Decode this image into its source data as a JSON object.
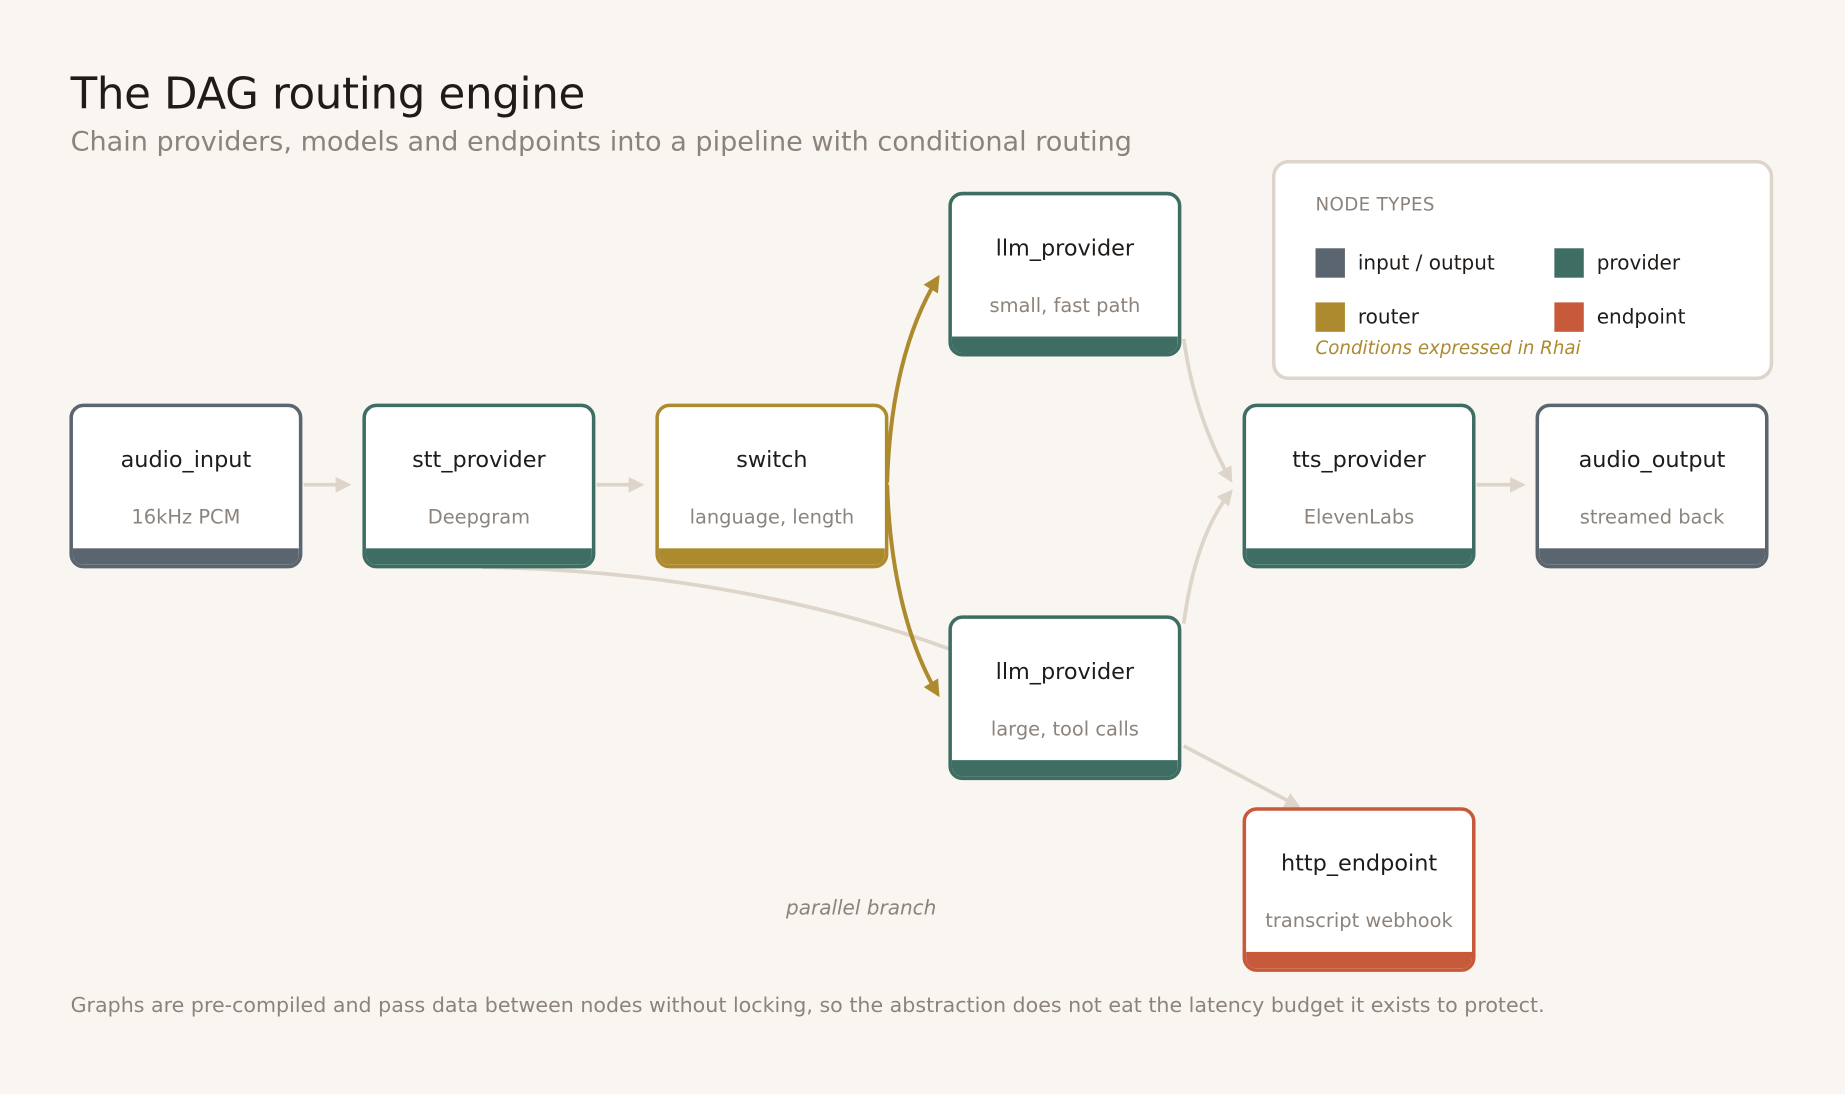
{
  "title": "The DAG routing engine",
  "subtitle": "Chain providers, models and endpoints into a pipeline with conditional routing",
  "footer": "Graphs are pre-compiled and pass data between nodes without locking, so the abstraction does not eat the latency budget it exists to protect.",
  "annotation": "parallel branch",
  "colors": {
    "io": "#5b6570",
    "provider": "#3e6e63",
    "router": "#ad8a2e",
    "endpoint": "#c65a3a",
    "edge": "#ddd5c9",
    "conditional_edge": "#ad8a2e"
  },
  "nodes": [
    {
      "id": "audio_input",
      "title": "audio_input",
      "subtitle": "16kHz PCM",
      "type": "io"
    },
    {
      "id": "stt_provider",
      "title": "stt_provider",
      "subtitle": "Deepgram",
      "type": "provider"
    },
    {
      "id": "switch",
      "title": "switch",
      "subtitle": "language, length",
      "type": "router"
    },
    {
      "id": "llm_small",
      "title": "llm_provider",
      "subtitle": "small, fast path",
      "type": "provider"
    },
    {
      "id": "llm_large",
      "title": "llm_provider",
      "subtitle": "large, tool calls",
      "type": "provider"
    },
    {
      "id": "tts_provider",
      "title": "tts_provider",
      "subtitle": "ElevenLabs",
      "type": "provider"
    },
    {
      "id": "audio_output",
      "title": "audio_output",
      "subtitle": "streamed back",
      "type": "io"
    },
    {
      "id": "http_endpoint",
      "title": "http_endpoint",
      "subtitle": "transcript webhook",
      "type": "endpoint"
    }
  ],
  "edges": [
    {
      "from": "audio_input",
      "to": "stt_provider",
      "kind": "data"
    },
    {
      "from": "stt_provider",
      "to": "switch",
      "kind": "data"
    },
    {
      "from": "switch",
      "to": "llm_small",
      "kind": "conditional"
    },
    {
      "from": "switch",
      "to": "llm_large",
      "kind": "conditional"
    },
    {
      "from": "stt_provider",
      "to": "llm_large",
      "kind": "parallel"
    },
    {
      "from": "llm_small",
      "to": "tts_provider",
      "kind": "data"
    },
    {
      "from": "llm_large",
      "to": "tts_provider",
      "kind": "data"
    },
    {
      "from": "tts_provider",
      "to": "audio_output",
      "kind": "data"
    },
    {
      "from": "llm_large",
      "to": "http_endpoint",
      "kind": "data"
    }
  ],
  "legend": {
    "title": "NODE TYPES",
    "items": [
      {
        "type": "io",
        "label": "input / output"
      },
      {
        "type": "provider",
        "label": "provider"
      },
      {
        "type": "router",
        "label": "router"
      },
      {
        "type": "endpoint",
        "label": "endpoint"
      }
    ],
    "note": "Conditions expressed in Rhai"
  }
}
